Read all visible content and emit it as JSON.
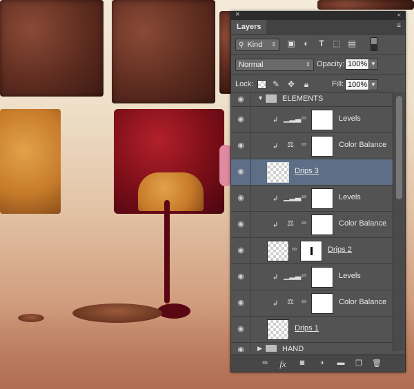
{
  "panel": {
    "close_glyph": "×",
    "collapse_glyph": "«",
    "tab_label": "Layers",
    "menu_glyph": "≡"
  },
  "filter": {
    "kind_label": "Kind",
    "icons": [
      "image-filter-icon",
      "adjustment-filter-icon",
      "type-filter-icon",
      "shape-filter-icon",
      "smart-object-filter-icon"
    ]
  },
  "blend": {
    "mode": "Normal",
    "opacity_label": "Opacity:",
    "opacity_value": "100%"
  },
  "lock": {
    "label": "Lock:",
    "fill_label": "Fill:",
    "fill_value": "100%"
  },
  "layers": {
    "group_elements": "ELEMENTS",
    "levels_1": "Levels",
    "color_balance_1": "Color Balance",
    "drips_3": "Drips 3",
    "levels_2": "Levels",
    "color_balance_2": "Color Balance",
    "drips_2": "Drips 2",
    "levels_3": "Levels",
    "color_balance_3": "Color Balance",
    "drips_1": "Drips 1",
    "group_hand": "HAND"
  },
  "bottom_icons": [
    "link-layers-icon",
    "fx-icon",
    "add-mask-icon",
    "new-adjustment-icon",
    "new-group-icon",
    "new-layer-icon",
    "delete-icon"
  ],
  "fx_label": "fx"
}
